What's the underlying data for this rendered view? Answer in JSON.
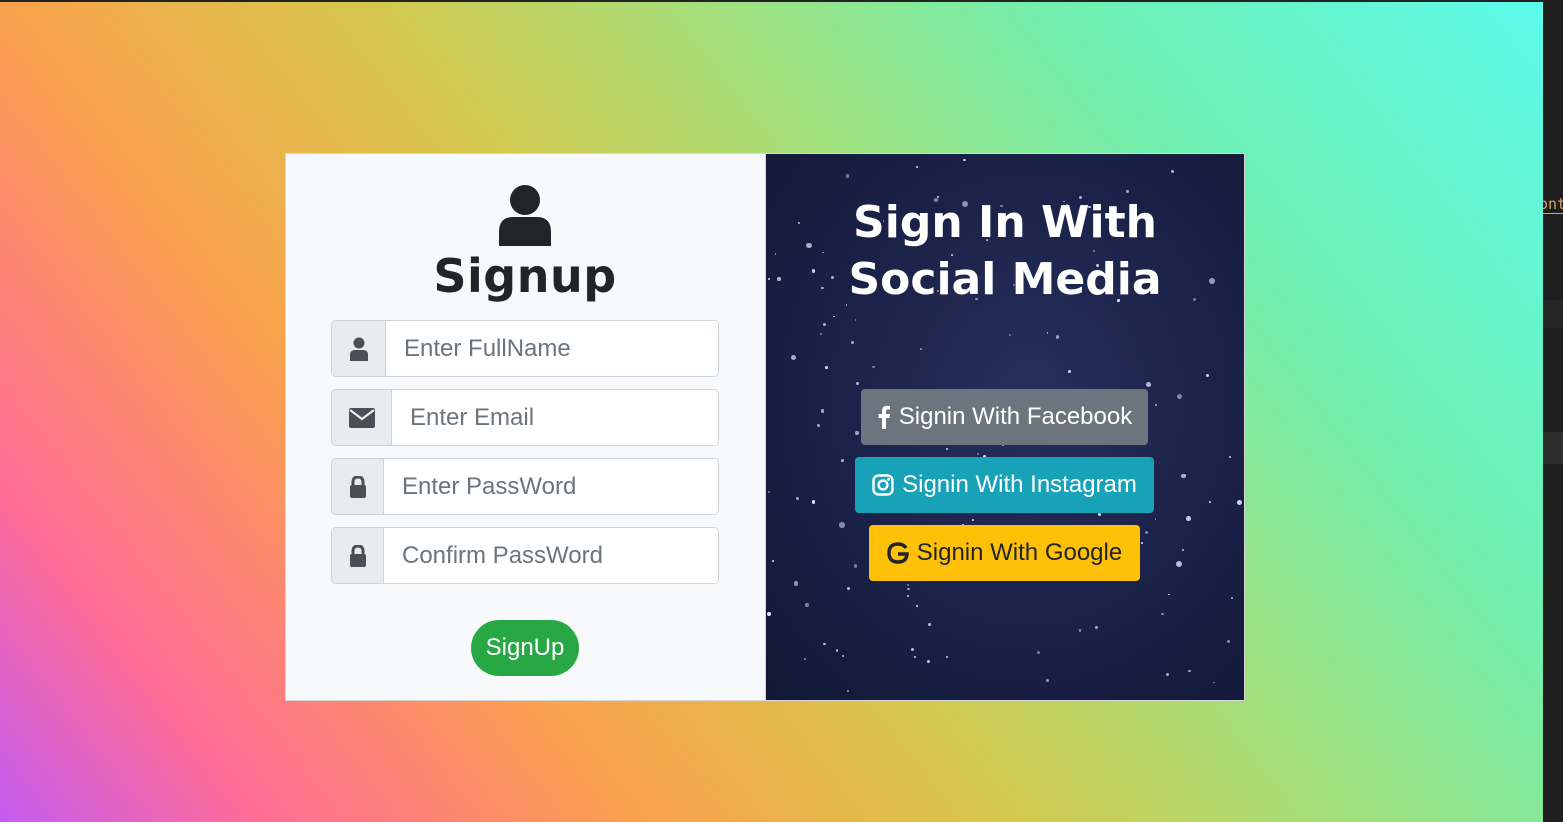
{
  "signup_panel": {
    "hero_icon": "user-icon",
    "title": "Signup",
    "fields": [
      {
        "icon": "user-icon",
        "placeholder": "Enter FullName",
        "value": ""
      },
      {
        "icon": "envelope-icon",
        "placeholder": "Enter Email",
        "value": ""
      },
      {
        "icon": "lock-icon",
        "placeholder": "Enter PassWord",
        "value": ""
      },
      {
        "icon": "lock-icon",
        "placeholder": "Confirm PassWord",
        "value": ""
      }
    ],
    "submit_label": "SignUp"
  },
  "social_panel": {
    "title_line1": "Sign In With",
    "title_line2": "Social Media",
    "buttons": [
      {
        "icon": "facebook-icon",
        "label": "Signin With Facebook",
        "color": "#6c757d"
      },
      {
        "icon": "instagram-icon",
        "label": "Signin With Instagram",
        "color": "#17a2b8"
      },
      {
        "icon": "google-icon",
        "label": "Signin With Google",
        "color": "#ffc107"
      }
    ]
  },
  "editor_edge": {
    "fragment": "ont"
  },
  "colors": {
    "signup_button": "#28a745",
    "panel_background": "#f8f9fa",
    "social_background": "#1a2147"
  }
}
